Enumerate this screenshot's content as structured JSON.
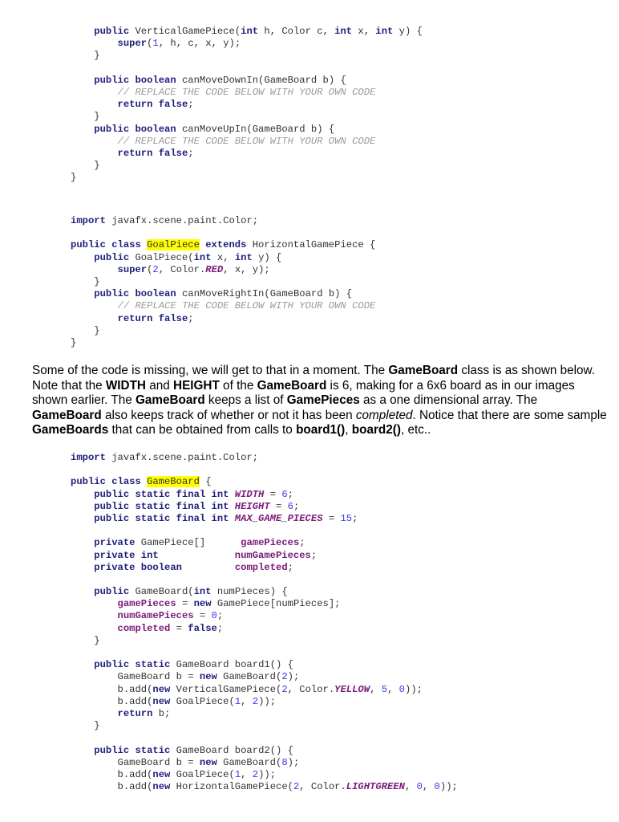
{
  "code_block_1": [
    [
      [
        "    ",
        "plain"
      ],
      [
        "public ",
        "kw"
      ],
      [
        "VerticalGamePiece(",
        "plain"
      ],
      [
        "int ",
        "kw"
      ],
      [
        "h, Color c, ",
        "plain"
      ],
      [
        "int ",
        "kw"
      ],
      [
        "x, ",
        "plain"
      ],
      [
        "int ",
        "kw"
      ],
      [
        "y) {",
        "plain"
      ]
    ],
    [
      [
        "        ",
        "plain"
      ],
      [
        "super",
        "kw"
      ],
      [
        "(",
        "plain"
      ],
      [
        "1",
        "num"
      ],
      [
        ", h, c, x, y);",
        "plain"
      ]
    ],
    [
      [
        "    }",
        "plain"
      ]
    ],
    [
      [
        "",
        "plain"
      ]
    ],
    [
      [
        "    ",
        "plain"
      ],
      [
        "public boolean ",
        "kw"
      ],
      [
        "canMoveDownIn(GameBoard b) {",
        "plain"
      ]
    ],
    [
      [
        "        ",
        "plain"
      ],
      [
        "// REPLACE THE CODE BELOW WITH YOUR OWN CODE",
        "cmt"
      ]
    ],
    [
      [
        "        ",
        "plain"
      ],
      [
        "return false",
        "kw"
      ],
      [
        ";",
        "plain"
      ]
    ],
    [
      [
        "    }",
        "plain"
      ]
    ],
    [
      [
        "    ",
        "plain"
      ],
      [
        "public boolean ",
        "kw"
      ],
      [
        "canMoveUpIn(GameBoard b) {",
        "plain"
      ]
    ],
    [
      [
        "        ",
        "plain"
      ],
      [
        "// REPLACE THE CODE BELOW WITH YOUR OWN CODE",
        "cmt"
      ]
    ],
    [
      [
        "        ",
        "plain"
      ],
      [
        "return false",
        "kw"
      ],
      [
        ";",
        "plain"
      ]
    ],
    [
      [
        "    }",
        "plain"
      ]
    ],
    [
      [
        "}",
        "plain"
      ]
    ]
  ],
  "code_block_2": [
    [
      [
        "import ",
        "kw"
      ],
      [
        "javafx.scene.paint.Color;",
        "plain"
      ]
    ],
    [
      [
        "",
        "plain"
      ]
    ],
    [
      [
        "public class ",
        "kw"
      ],
      [
        "GoalPiece",
        "hl"
      ],
      [
        " extends ",
        "kw"
      ],
      [
        "HorizontalGamePiece {",
        "plain"
      ]
    ],
    [
      [
        "    ",
        "plain"
      ],
      [
        "public ",
        "kw"
      ],
      [
        "GoalPiece(",
        "plain"
      ],
      [
        "int ",
        "kw"
      ],
      [
        "x, ",
        "plain"
      ],
      [
        "int ",
        "kw"
      ],
      [
        "y) {",
        "plain"
      ]
    ],
    [
      [
        "        ",
        "plain"
      ],
      [
        "super",
        "kw"
      ],
      [
        "(",
        "plain"
      ],
      [
        "2",
        "num"
      ],
      [
        ", Color.",
        "plain"
      ],
      [
        "RED",
        "const"
      ],
      [
        ", x, y);",
        "plain"
      ]
    ],
    [
      [
        "    }",
        "plain"
      ]
    ],
    [
      [
        "    ",
        "plain"
      ],
      [
        "public boolean ",
        "kw"
      ],
      [
        "canMoveRightIn(GameBoard b) {",
        "plain"
      ]
    ],
    [
      [
        "        ",
        "plain"
      ],
      [
        "// REPLACE THE CODE BELOW WITH YOUR OWN CODE",
        "cmt"
      ]
    ],
    [
      [
        "        ",
        "plain"
      ],
      [
        "return false",
        "kw"
      ],
      [
        ";",
        "plain"
      ]
    ],
    [
      [
        "    }",
        "plain"
      ]
    ],
    [
      [
        "}",
        "plain"
      ]
    ]
  ],
  "prose": {
    "segments": [
      [
        "Some of the code is missing, we will get to that in a moment.   The ",
        "n"
      ],
      [
        "GameBoard",
        "b"
      ],
      [
        " class is as shown below.   Note that the ",
        "n"
      ],
      [
        "WIDTH",
        "b"
      ],
      [
        " and ",
        "n"
      ],
      [
        "HEIGHT",
        "b"
      ],
      [
        " of the ",
        "n"
      ],
      [
        "GameBoard",
        "b"
      ],
      [
        " is 6, making for a 6x6 board as in our images shown earlier.   The ",
        "n"
      ],
      [
        "GameBoard",
        "b"
      ],
      [
        " keeps a list of ",
        "n"
      ],
      [
        "GamePieces",
        "b"
      ],
      [
        " as a one dimensional array. The ",
        "n"
      ],
      [
        "GameBoard",
        "b"
      ],
      [
        " also keeps track of whether or not it has been ",
        "n"
      ],
      [
        "completed",
        "i"
      ],
      [
        ".   Notice that there are some sample ",
        "n"
      ],
      [
        "GameBoards",
        "b"
      ],
      [
        " that can be obtained from calls to ",
        "n"
      ],
      [
        "board1()",
        "b"
      ],
      [
        ", ",
        "n"
      ],
      [
        "board2()",
        "b"
      ],
      [
        ", etc..",
        "n"
      ]
    ]
  },
  "code_block_3": [
    [
      [
        "import ",
        "kw"
      ],
      [
        "javafx.scene.paint.Color;",
        "plain"
      ]
    ],
    [
      [
        "",
        "plain"
      ]
    ],
    [
      [
        "public class ",
        "kw"
      ],
      [
        "GameBoard",
        "hl"
      ],
      [
        " {",
        "plain"
      ]
    ],
    [
      [
        "    ",
        "plain"
      ],
      [
        "public static final int ",
        "kw"
      ],
      [
        "WIDTH",
        "const"
      ],
      [
        " = ",
        "plain"
      ],
      [
        "6",
        "num"
      ],
      [
        ";",
        "plain"
      ]
    ],
    [
      [
        "    ",
        "plain"
      ],
      [
        "public static final int ",
        "kw"
      ],
      [
        "HEIGHT",
        "const"
      ],
      [
        " = ",
        "plain"
      ],
      [
        "6",
        "num"
      ],
      [
        ";",
        "plain"
      ]
    ],
    [
      [
        "    ",
        "plain"
      ],
      [
        "public static final int ",
        "kw"
      ],
      [
        "MAX_GAME_PIECES",
        "const"
      ],
      [
        " = ",
        "plain"
      ],
      [
        "15",
        "num"
      ],
      [
        ";",
        "plain"
      ]
    ],
    [
      [
        "",
        "plain"
      ]
    ],
    [
      [
        "    ",
        "plain"
      ],
      [
        "private ",
        "kw"
      ],
      [
        "GamePiece[]      ",
        "plain"
      ],
      [
        "gamePieces",
        "field"
      ],
      [
        ";",
        "plain"
      ]
    ],
    [
      [
        "    ",
        "plain"
      ],
      [
        "private int",
        "kw"
      ],
      [
        "             ",
        "plain"
      ],
      [
        "numGamePieces",
        "field"
      ],
      [
        ";",
        "plain"
      ]
    ],
    [
      [
        "    ",
        "plain"
      ],
      [
        "private boolean",
        "kw"
      ],
      [
        "         ",
        "plain"
      ],
      [
        "completed",
        "field"
      ],
      [
        ";",
        "plain"
      ]
    ],
    [
      [
        "",
        "plain"
      ]
    ],
    [
      [
        "    ",
        "plain"
      ],
      [
        "public ",
        "kw"
      ],
      [
        "GameBoard(",
        "plain"
      ],
      [
        "int ",
        "kw"
      ],
      [
        "numPieces) {",
        "plain"
      ]
    ],
    [
      [
        "        ",
        "plain"
      ],
      [
        "gamePieces",
        "field"
      ],
      [
        " = ",
        "plain"
      ],
      [
        "new ",
        "kw"
      ],
      [
        "GamePiece[numPieces];",
        "plain"
      ]
    ],
    [
      [
        "        ",
        "plain"
      ],
      [
        "numGamePieces",
        "field"
      ],
      [
        " = ",
        "plain"
      ],
      [
        "0",
        "num"
      ],
      [
        ";",
        "plain"
      ]
    ],
    [
      [
        "        ",
        "plain"
      ],
      [
        "completed",
        "field"
      ],
      [
        " = ",
        "plain"
      ],
      [
        "false",
        "kw"
      ],
      [
        ";",
        "plain"
      ]
    ],
    [
      [
        "    }",
        "plain"
      ]
    ],
    [
      [
        "",
        "plain"
      ]
    ],
    [
      [
        "    ",
        "plain"
      ],
      [
        "public static ",
        "kw"
      ],
      [
        "GameBoard board1() {",
        "plain"
      ]
    ],
    [
      [
        "        GameBoard b = ",
        "plain"
      ],
      [
        "new ",
        "kw"
      ],
      [
        "GameBoard(",
        "plain"
      ],
      [
        "2",
        "num"
      ],
      [
        ");",
        "plain"
      ]
    ],
    [
      [
        "        b.add(",
        "plain"
      ],
      [
        "new ",
        "kw"
      ],
      [
        "VerticalGamePiece(",
        "plain"
      ],
      [
        "2",
        "num"
      ],
      [
        ", Color.",
        "plain"
      ],
      [
        "YELLOW",
        "const"
      ],
      [
        ", ",
        "plain"
      ],
      [
        "5",
        "num"
      ],
      [
        ", ",
        "plain"
      ],
      [
        "0",
        "num"
      ],
      [
        "));",
        "plain"
      ]
    ],
    [
      [
        "        b.add(",
        "plain"
      ],
      [
        "new ",
        "kw"
      ],
      [
        "GoalPiece(",
        "plain"
      ],
      [
        "1",
        "num"
      ],
      [
        ", ",
        "plain"
      ],
      [
        "2",
        "num"
      ],
      [
        "));",
        "plain"
      ]
    ],
    [
      [
        "        ",
        "plain"
      ],
      [
        "return ",
        "kw"
      ],
      [
        "b;",
        "plain"
      ]
    ],
    [
      [
        "    }",
        "plain"
      ]
    ],
    [
      [
        "",
        "plain"
      ]
    ],
    [
      [
        "    ",
        "plain"
      ],
      [
        "public static ",
        "kw"
      ],
      [
        "GameBoard board2() {",
        "plain"
      ]
    ],
    [
      [
        "        GameBoard b = ",
        "plain"
      ],
      [
        "new ",
        "kw"
      ],
      [
        "GameBoard(",
        "plain"
      ],
      [
        "8",
        "num"
      ],
      [
        ");",
        "plain"
      ]
    ],
    [
      [
        "        b.add(",
        "plain"
      ],
      [
        "new ",
        "kw"
      ],
      [
        "GoalPiece(",
        "plain"
      ],
      [
        "1",
        "num"
      ],
      [
        ", ",
        "plain"
      ],
      [
        "2",
        "num"
      ],
      [
        "));",
        "plain"
      ]
    ],
    [
      [
        "        b.add(",
        "plain"
      ],
      [
        "new ",
        "kw"
      ],
      [
        "HorizontalGamePiece(",
        "plain"
      ],
      [
        "2",
        "num"
      ],
      [
        ", Color.",
        "plain"
      ],
      [
        "LIGHTGREEN",
        "const"
      ],
      [
        ", ",
        "plain"
      ],
      [
        "0",
        "num"
      ],
      [
        ", ",
        "plain"
      ],
      [
        "0",
        "num"
      ],
      [
        "));",
        "plain"
      ]
    ]
  ]
}
